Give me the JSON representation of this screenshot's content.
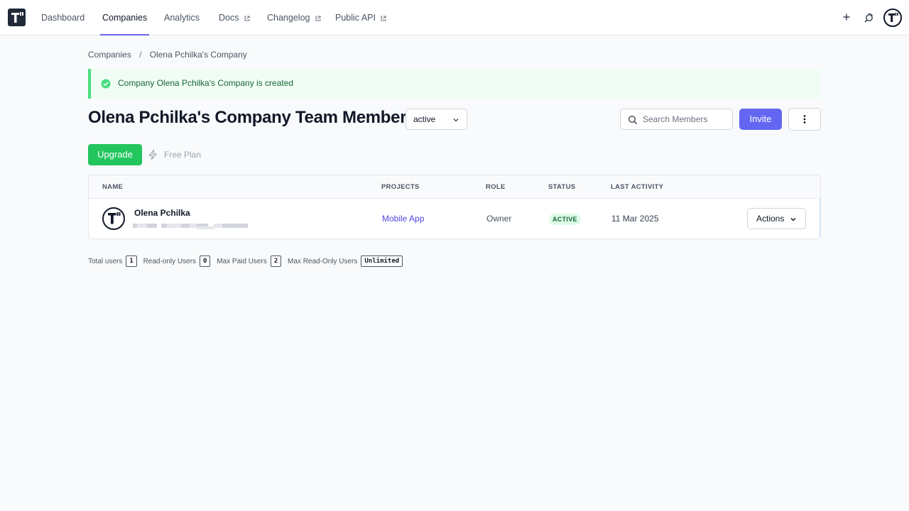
{
  "nav": {
    "items": [
      {
        "label": "Dashboard",
        "external": false,
        "active": false
      },
      {
        "label": "Companies",
        "external": false,
        "active": true
      },
      {
        "label": "Analytics",
        "external": false,
        "active": false
      },
      {
        "label": "Docs",
        "external": true,
        "active": false
      },
      {
        "label": "Changelog",
        "external": true,
        "active": false
      },
      {
        "label": "Public API",
        "external": true,
        "active": false
      }
    ],
    "right_icons": [
      "plus-icon",
      "search-user-icon",
      "avatar"
    ]
  },
  "breadcrumb": {
    "items": [
      "Companies",
      "Olena Pchilka's Company"
    ],
    "separator": "/"
  },
  "alert": {
    "text": "Company Olena Pchilka's Company is created",
    "icon": "check-circle-icon"
  },
  "page": {
    "title": "Olena Pchilka's Company Team Members",
    "status_filter": "active",
    "search_placeholder": "Search Members",
    "invite_label": "Invite",
    "upgrade_label": "Upgrade",
    "plan_label": "Free Plan"
  },
  "table": {
    "columns": [
      "NAME",
      "PROJECTS",
      "ROLE",
      "STATUS",
      "LAST ACTIVITY"
    ],
    "rows": [
      {
        "name": "Olena Pchilka",
        "project": "Mobile App",
        "role": "Owner",
        "status": "ACTIVE",
        "last_activity": "11 Mar 2025",
        "actions_label": "Actions"
      }
    ]
  },
  "stats": {
    "total_users_label": "Total users",
    "total_users": "1",
    "read_only_label": "Read-only Users",
    "read_only": "0",
    "max_paid_label": "Max Paid Users",
    "max_paid": "2",
    "max_read_only_label": "Max Read-Only Users",
    "max_read_only": "Unlimited"
  },
  "colors": {
    "accent": "#6366f1",
    "success": "#22c55e",
    "alert_bg": "#f0fdf4",
    "alert_border": "#4ade80",
    "link": "#4f46e5"
  }
}
